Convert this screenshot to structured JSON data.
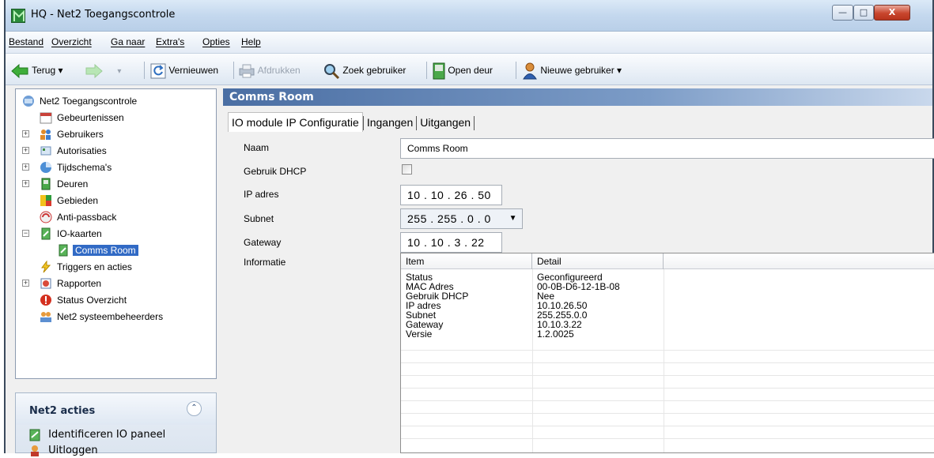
{
  "window": {
    "title": "HQ - Net2 Toegangscontrole",
    "controls": {
      "minimize": "—",
      "maximize": "□",
      "close": "X"
    }
  },
  "menu": [
    "Bestand",
    "Overzicht",
    "Ga naar",
    "Extra's",
    "Opties",
    "Help"
  ],
  "toolbar": {
    "back": "Terug ▾",
    "refresh": "Vernieuwen",
    "print": "Afdrukken",
    "find_user": "Zoek gebruiker",
    "open_door": "Open deur",
    "new_user": "Nieuwe gebruiker ▾"
  },
  "tree": [
    {
      "label": "Net2 Toegangscontrole",
      "icon": "network-root-icon"
    },
    {
      "label": "Gebeurtenissen",
      "icon": "events-icon"
    },
    {
      "label": "Gebruikers",
      "icon": "users-icon",
      "expander": "+"
    },
    {
      "label": "Autorisaties",
      "icon": "authorisations-icon",
      "expander": "+"
    },
    {
      "label": "Tijdschema's",
      "icon": "clock-icon",
      "expander": "+"
    },
    {
      "label": "Deuren",
      "icon": "door-icon",
      "expander": "+"
    },
    {
      "label": "Gebieden",
      "icon": "areas-icon"
    },
    {
      "label": "Anti-passback",
      "icon": "antipassback-icon"
    },
    {
      "label": "IO-kaarten",
      "icon": "io-board-icon",
      "expander": "−"
    },
    {
      "label": "Comms Room",
      "icon": "io-board-icon",
      "selected": true
    },
    {
      "label": "Triggers en acties",
      "icon": "lightning-icon"
    },
    {
      "label": "Rapporten",
      "icon": "reports-icon",
      "expander": "+"
    },
    {
      "label": "Status Overzicht",
      "icon": "status-icon"
    },
    {
      "label": "Net2 systeembeheerders",
      "icon": "admins-icon"
    }
  ],
  "actions": {
    "title": "Net2 acties",
    "collapse": "⌃",
    "items": [
      "Identificeren IO paneel",
      "Uitloggen"
    ]
  },
  "content": {
    "header": "Comms Room",
    "tabs": [
      "IO module IP Configuratie",
      "Ingangen",
      "Uitgangen"
    ],
    "fields": {
      "name_label": "Naam",
      "name_value": "Comms Room",
      "dhcp_label": "Gebruik DHCP",
      "dhcp_checked": false,
      "ip_label": "IP adres",
      "ip_value": "10 . 10 . 26 . 50",
      "subnet_label": "Subnet",
      "subnet_value": "255 . 255 .  0  .  0",
      "gateway_label": "Gateway",
      "gateway_value": "10 . 10 .  3  . 22",
      "info_label": "Informatie"
    },
    "info_table": {
      "columns": [
        "Item",
        "Detail",
        ""
      ],
      "rows": [
        [
          "Status",
          "Geconfigureerd"
        ],
        [
          "MAC Adres",
          "00-0B-D6-12-1B-08"
        ],
        [
          "Gebruik DHCP",
          "Nee"
        ],
        [
          "IP adres",
          "10.10.26.50"
        ],
        [
          "Subnet",
          "255.255.0.0"
        ],
        [
          "Gateway",
          "10.10.3.22"
        ],
        [
          "Versie",
          "1.2.0025"
        ]
      ]
    }
  },
  "colors": {
    "selection": "#316ac5",
    "header_gradient_start": "#4a6ea3",
    "frame": "#3b4a5c"
  }
}
